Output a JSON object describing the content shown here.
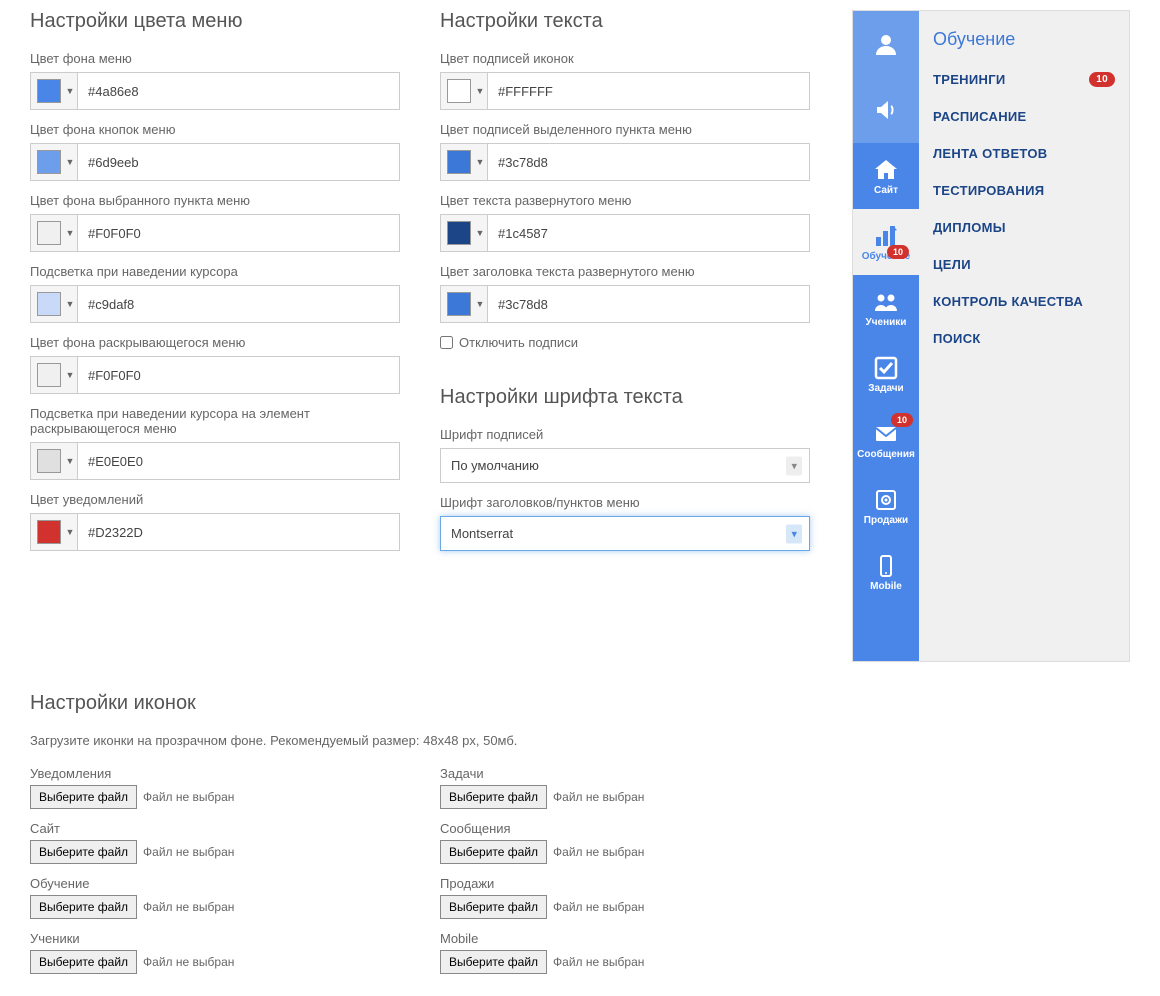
{
  "sections": {
    "menu_color": "Настройки цвета меню",
    "text": "Настройки текста",
    "font": "Настройки шрифта текста",
    "icons": "Настройки иконок"
  },
  "color_fields_left": [
    {
      "label": "Цвет фона меню",
      "value": "#4a86e8",
      "swatch": "#4a86e8"
    },
    {
      "label": "Цвет фона кнопок меню",
      "value": "#6d9eeb",
      "swatch": "#6d9eeb"
    },
    {
      "label": "Цвет фона выбранного пункта меню",
      "value": "#F0F0F0",
      "swatch": "#F0F0F0"
    },
    {
      "label": "Подсветка при наведении курсора",
      "value": "#c9daf8",
      "swatch": "#c9daf8"
    },
    {
      "label": "Цвет фона раскрывающегося меню",
      "value": "#F0F0F0",
      "swatch": "#F0F0F0"
    },
    {
      "label": "Подсветка при наведении курсора на элемент раскрывающегося меню",
      "value": "#E0E0E0",
      "swatch": "#E0E0E0"
    },
    {
      "label": "Цвет уведомлений",
      "value": "#D2322D",
      "swatch": "#D2322D"
    }
  ],
  "color_fields_right": [
    {
      "label": "Цвет подписей иконок",
      "value": "#FFFFFF",
      "swatch": "#FFFFFF"
    },
    {
      "label": "Цвет подписей выделенного пункта меню",
      "value": "#3c78d8",
      "swatch": "#3c78d8"
    },
    {
      "label": "Цвет текста развернутого меню",
      "value": "#1c4587",
      "swatch": "#1c4587"
    },
    {
      "label": "Цвет заголовка текста развернутого меню",
      "value": "#3c78d8",
      "swatch": "#3c78d8"
    }
  ],
  "disable_labels": "Отключить подписи",
  "font_fields": [
    {
      "label": "Шрифт подписей",
      "value": "По умолчанию"
    },
    {
      "label": "Шрифт заголовков/пунктов меню",
      "value": "Montserrat"
    }
  ],
  "icons_desc": "Загрузите иконки на прозрачном фоне. Рекомендуемый размер: 48х48 px, 50мб.",
  "file_btn": "Выберите файл",
  "file_status": "Файл не выбран",
  "icon_uploads_left": [
    "Уведомления",
    "Сайт",
    "Обучение",
    "Ученики"
  ],
  "icon_uploads_right": [
    "Задачи",
    "Сообщения",
    "Продажи",
    "Mobile"
  ],
  "preview": {
    "title": "Обучение",
    "badge": "10",
    "icons": [
      {
        "name": "user",
        "label": "",
        "light": true
      },
      {
        "name": "speaker",
        "label": "",
        "light": true
      },
      {
        "name": "home",
        "label": "Сайт"
      },
      {
        "name": "chart",
        "label": "Обучение",
        "selected": true,
        "badge": "10"
      },
      {
        "name": "people",
        "label": "Ученики"
      },
      {
        "name": "check",
        "label": "Задачи"
      },
      {
        "name": "mail",
        "label": "Сообщения",
        "badge": "10"
      },
      {
        "name": "safe",
        "label": "Продажи"
      },
      {
        "name": "phone",
        "label": "Mobile"
      }
    ],
    "menu": [
      {
        "label": "ТРЕНИНГИ",
        "badge": "10"
      },
      {
        "label": "РАСПИСАНИЕ"
      },
      {
        "label": "ЛЕНТА ОТВЕТОВ"
      },
      {
        "label": "ТЕСТИРОВАНИЯ"
      },
      {
        "label": "ДИПЛОМЫ"
      },
      {
        "label": "ЦЕЛИ"
      },
      {
        "label": "КОНТРОЛЬ КАЧЕСТВА"
      },
      {
        "label": "ПОИСК"
      }
    ]
  }
}
